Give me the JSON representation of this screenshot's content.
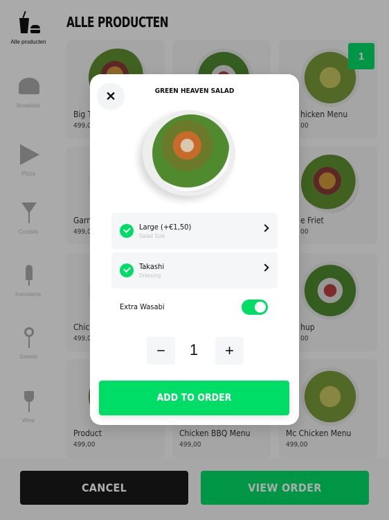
{
  "sidebar": {
    "items": [
      {
        "label": "Alle producten",
        "icon": "drink-burger-icon",
        "active": true
      },
      {
        "label": "Breakfast",
        "icon": "croissant-icon"
      },
      {
        "label": "Pizza",
        "icon": "pizza-icon"
      },
      {
        "label": "Coctails",
        "icon": "cocktail-icon"
      },
      {
        "label": "Icecreams",
        "icon": "icecream-icon"
      },
      {
        "label": "Sweets",
        "icon": "lollipop-icon"
      },
      {
        "label": "Wine",
        "icon": "wine-glass-icon"
      }
    ]
  },
  "header": {
    "title": "ALLE PRODUCTEN"
  },
  "products": [
    {
      "name": "Big Ta",
      "price": "499,00"
    },
    {
      "name": "",
      "price": ""
    },
    {
      "name": "hicken Menu",
      "price": "00",
      "badge": "1"
    },
    {
      "name": "Garna",
      "price": "499,00"
    },
    {
      "name": "",
      "price": ""
    },
    {
      "name": "e Friet",
      "price": "00"
    },
    {
      "name": "Chick",
      "price": "499,00"
    },
    {
      "name": "",
      "price": ""
    },
    {
      "name": "hup",
      "price": "00"
    },
    {
      "name": "Product",
      "price": "499,00"
    },
    {
      "name": "Chicken BBQ Menu",
      "price": "499,00"
    },
    {
      "name": "Mc Chicken Menu",
      "price": "499,00"
    }
  ],
  "footer": {
    "cancel": "CANCEL",
    "view_order": "VIEW ORDER"
  },
  "modal": {
    "title": "GREEN HEAVEN SALAD",
    "options": [
      {
        "label": "Large (+€1,50)",
        "sub": "Salad Size",
        "checked": true
      },
      {
        "label": "Takashi",
        "sub": "Dressing",
        "checked": true
      }
    ],
    "toggle": {
      "label": "Extra Wasabi",
      "on": true
    },
    "quantity": "1",
    "add": "ADD TO ORDER"
  },
  "colors": {
    "accent": "#00dd66",
    "view_order": "#0f9d4a",
    "cancel": "#1a1a1a",
    "badge": "#0f9d4a"
  }
}
